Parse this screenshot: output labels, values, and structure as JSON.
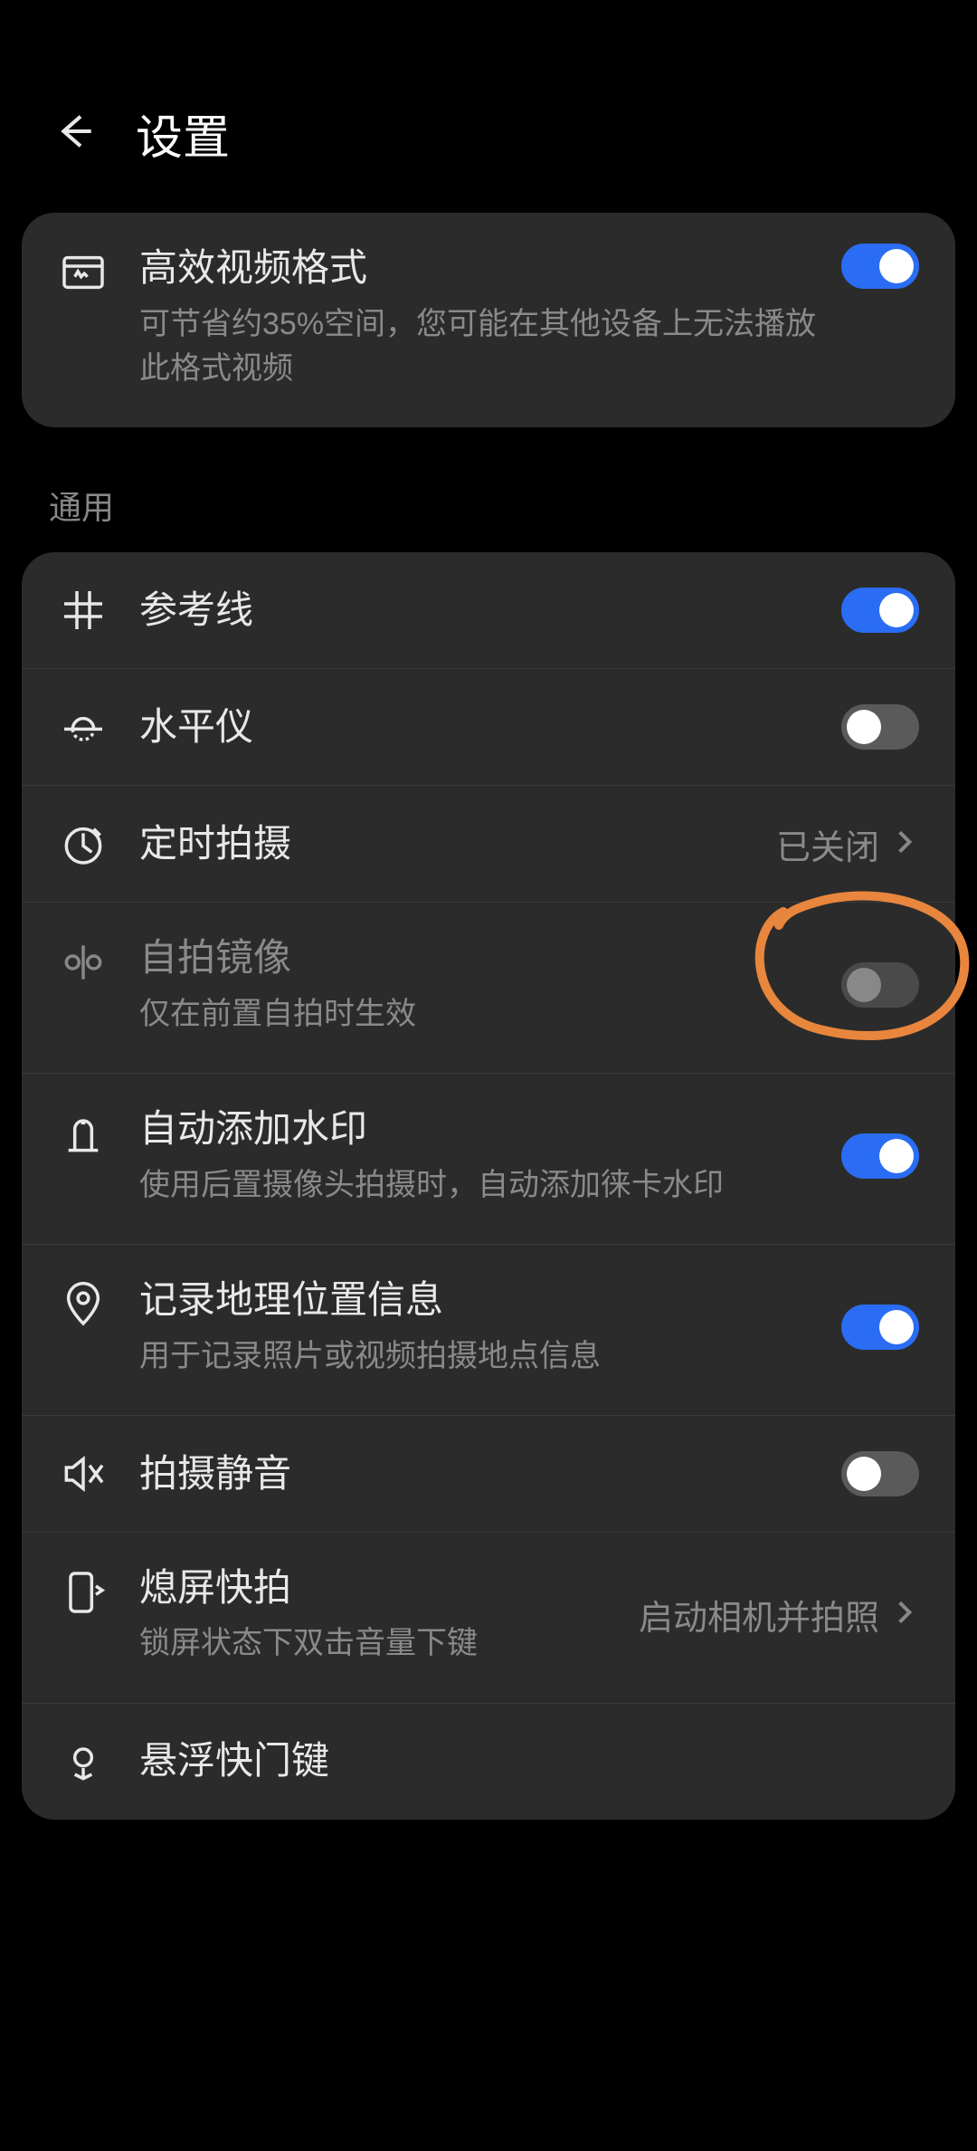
{
  "header": {
    "title": "设置"
  },
  "section1": {
    "video_format": {
      "title": "高效视频格式",
      "sub": "可节省约35%空间，您可能在其他设备上无法播放此格式视频",
      "enabled": true
    }
  },
  "section_general_label": "通用",
  "general": {
    "grid": {
      "title": "参考线",
      "enabled": true
    },
    "level": {
      "title": "水平仪",
      "enabled": false
    },
    "timer": {
      "title": "定时拍摄",
      "value": "已关闭"
    },
    "mirror": {
      "title": "自拍镜像",
      "sub": "仅在前置自拍时生效",
      "enabled": false,
      "disabled_row": true
    },
    "watermark": {
      "title": "自动添加水印",
      "sub": "使用后置摄像头拍摄时，自动添加徕卡水印",
      "enabled": true
    },
    "geo": {
      "title": "记录地理位置信息",
      "sub": "用于记录照片或视频拍摄地点信息",
      "enabled": true
    },
    "mute": {
      "title": "拍摄静音",
      "enabled": false
    },
    "quick": {
      "title": "熄屏快拍",
      "sub": "锁屏状态下双击音量下键",
      "value": "启动相机并拍照"
    },
    "float": {
      "title": "悬浮快门键"
    }
  }
}
